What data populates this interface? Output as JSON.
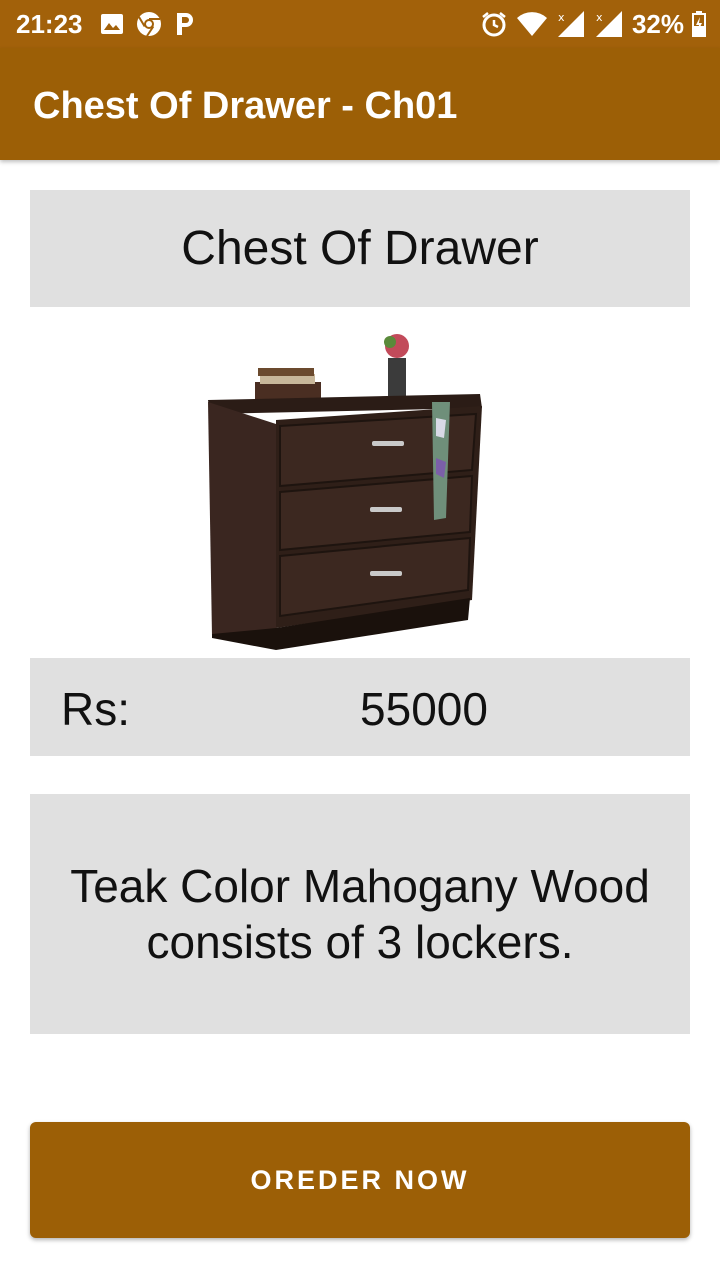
{
  "status_bar": {
    "time": "21:23",
    "battery": "32%",
    "left_icons": [
      "image-icon",
      "chrome-icon",
      "p-icon"
    ],
    "right_icons": [
      "alarm-icon",
      "wifi-icon",
      "signal-icon",
      "signal-icon",
      "battery-icon"
    ]
  },
  "app_bar": {
    "title": "Chest Of Drawer - Ch01"
  },
  "product": {
    "name": "Chest Of Drawer",
    "price_label": "Rs:",
    "price": "55000",
    "description": "Teak Color Mahogany Wood consists of 3 lockers."
  },
  "actions": {
    "order_label": "OREDER NOW"
  },
  "colors": {
    "status_bar": "#a2610a",
    "app_bar": "#9c5f06",
    "panel": "#e0e0e0",
    "button": "#9c5f06"
  }
}
